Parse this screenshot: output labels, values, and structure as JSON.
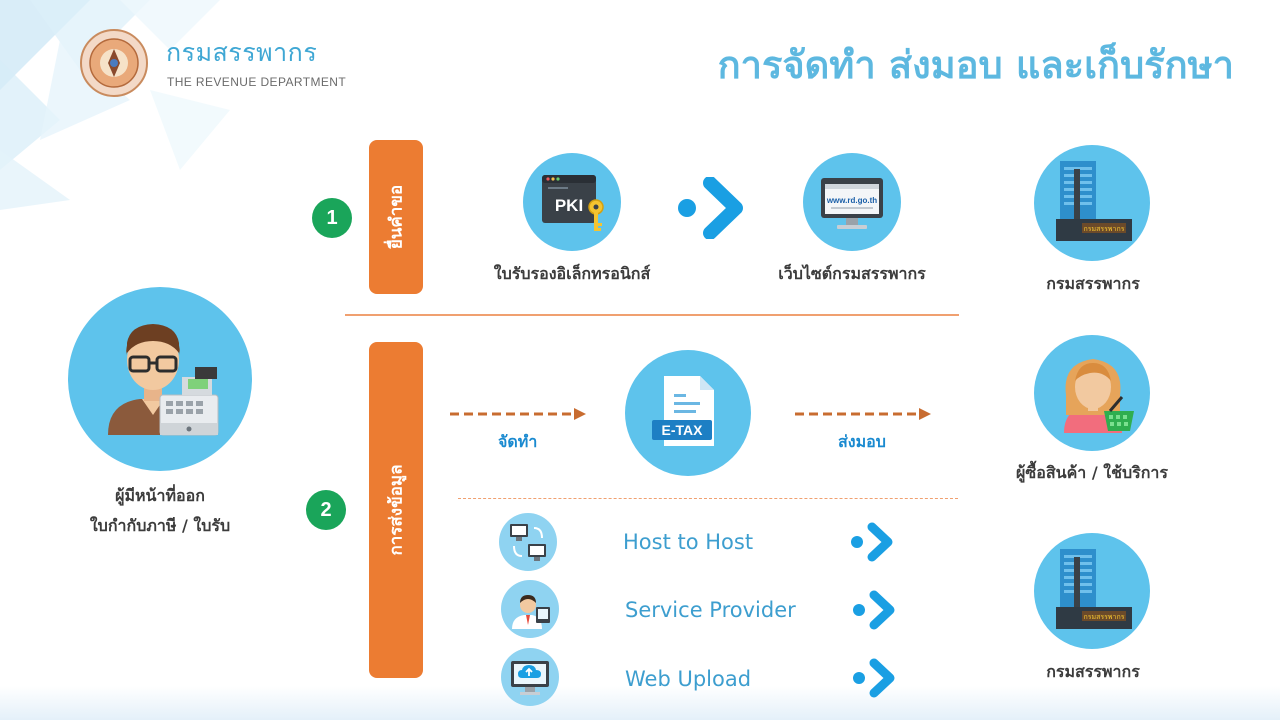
{
  "header": {
    "brand_th": "กรมสรรพากร",
    "brand_en": "THE REVENUE DEPARTMENT",
    "title": "การจัดทำ ส่งมอบ และเก็บรักษา"
  },
  "issuer": {
    "label_line1": "ผู้มีหน้าที่ออก",
    "label_line2": "ใบกำกับภาษี / ใบรับ"
  },
  "steps": [
    {
      "number": "1",
      "bar_label": "ยื่นคำขอ"
    },
    {
      "number": "2",
      "bar_label": "การส่งข้อมูล"
    }
  ],
  "step1": {
    "cert_label": "ใบรับรองอิเล็กทรอนิกส์",
    "pki_text": "PKI",
    "website_label": "เว็บไซต์กรมสรรพากร",
    "website_url": "www.rd.go.th"
  },
  "step2": {
    "make_label": "จัดทำ",
    "deliver_label": "ส่งมอบ",
    "etax_text": "E-TAX",
    "channels": [
      {
        "label": "Host to Host",
        "icon": "computers-exchange-icon"
      },
      {
        "label": "Service Provider",
        "icon": "service-provider-icon"
      },
      {
        "label": "Web Upload",
        "icon": "cloud-upload-icon"
      }
    ]
  },
  "recipients": [
    {
      "label": "กรมสรรพากร",
      "sign": "กรมสรรพากร"
    },
    {
      "label": "ผู้ซื้อสินค้า / ใช้บริการ"
    },
    {
      "label": "กรมสรรพากร",
      "sign": "กรมสรรพากร"
    }
  ],
  "colors": {
    "title_blue": "#5db8e0",
    "circle_blue": "#5ec3ec",
    "orange": "#ec7c32",
    "green_badge": "#1aa55a",
    "arrow_blue": "#1a9fe3"
  }
}
